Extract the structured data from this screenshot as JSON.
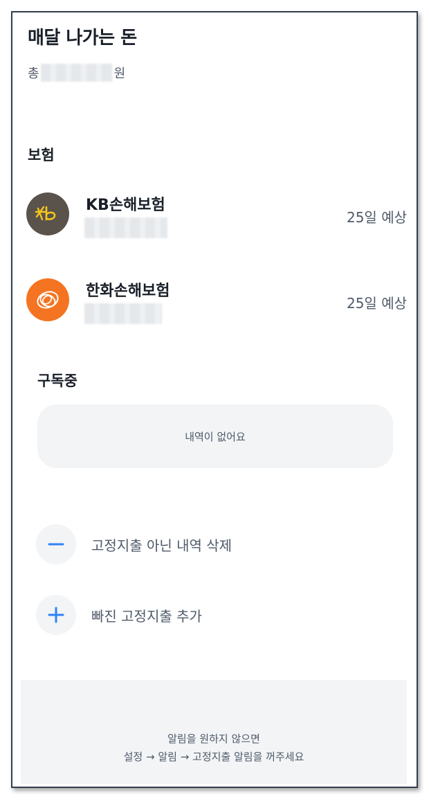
{
  "header": {
    "title": "매달 나가는 돈",
    "total_prefix": "총",
    "total_suffix": "원"
  },
  "insurance": {
    "label": "보험",
    "items": [
      {
        "name": "KB손해보험",
        "due": "25일 예상",
        "logo_color": "#5a534b",
        "logo_icon": "kb-logo-icon"
      },
      {
        "name": "한화손해보험",
        "due": "25일 예상",
        "logo_color": "#f47421",
        "logo_icon": "hanwha-logo-icon"
      }
    ]
  },
  "subscription": {
    "label": "구독중",
    "empty_text": "내역이 없어요"
  },
  "actions": [
    {
      "label": "고정지출 아닌 내역 삭제",
      "icon": "minus-icon"
    },
    {
      "label": "빠진 고정지출 추가",
      "icon": "plus-icon"
    }
  ],
  "footer": {
    "line1": "알림을 원하지 않으면",
    "line2": "설정 → 알림 → 고정지출 알림을 꺼주세요"
  },
  "colors": {
    "accent": "#3182f6",
    "background_gray": "#f2f4f6",
    "text_primary": "#191f28",
    "text_secondary": "#4e5968"
  }
}
